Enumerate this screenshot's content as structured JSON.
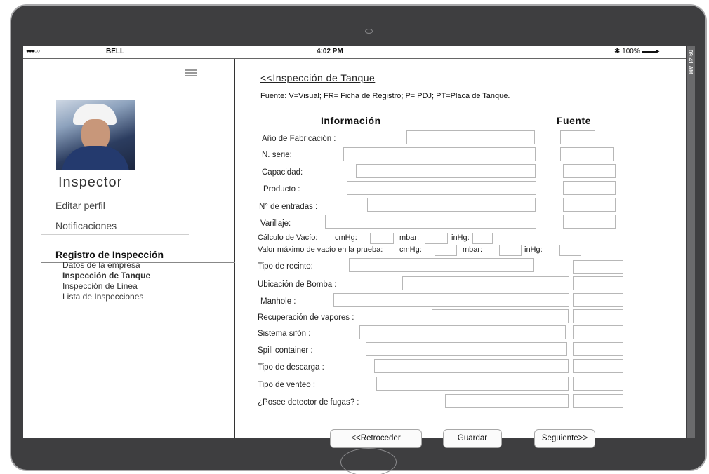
{
  "statusbar": {
    "carrier": "●●●○○",
    "network": "BELL",
    "time": "4:02 PM",
    "battery": "✱ 100% ▬▬▸"
  },
  "side_strip": "09:41 AM",
  "sidebar": {
    "name": "Inspector",
    "menu": [
      {
        "label": "Editar perfil"
      },
      {
        "label": "Notificaciones"
      }
    ],
    "group": {
      "label": "Registro de Inspección",
      "items": [
        {
          "label": "Datos de la empresa"
        },
        {
          "label": "Inspección de Tanque"
        },
        {
          "label": "Inspección de Linea"
        },
        {
          "label": "Lista de Inspecciones"
        }
      ]
    }
  },
  "main": {
    "back": "<<Inspección de Tanque",
    "legend": "Fuente: V=Visual; FR= Ficha de Registro; P= PDJ; PT=Placa de Tanque.",
    "col_info": "Información",
    "col_fuente": "Fuente",
    "fields": [
      {
        "label": "Año de Fabricación  :",
        "value": "",
        "fuente": ""
      },
      {
        "label": "N. serie:",
        "value": "",
        "fuente": ""
      },
      {
        "label": "Capacidad:",
        "value": "",
        "fuente": ""
      },
      {
        "label": "Producto :",
        "value": "",
        "fuente": ""
      },
      {
        "label": "N° de entradas  :",
        "value": "",
        "fuente": ""
      },
      {
        "label": "Varillaje:",
        "value": "",
        "fuente": ""
      }
    ],
    "vacio": {
      "calc_label": "Cálculo de Vacío:",
      "max_label": "Valor máximo de vacío en la prueba:",
      "units": [
        "cmHg:",
        "mbar:",
        "inHg:"
      ]
    },
    "fields2": [
      {
        "label": "Tipo de recinto:",
        "value": "",
        "fuente": ""
      },
      {
        "label": "Ubicación de Bomba   :",
        "value": "",
        "fuente": ""
      },
      {
        "label": "Manhole :",
        "value": "",
        "fuente": ""
      },
      {
        "label": "Recuperación de vapores   :",
        "value": "",
        "fuente": ""
      },
      {
        "label": "Sistema sifón  :",
        "value": "",
        "fuente": ""
      },
      {
        "label": "Spill container  :",
        "value": "",
        "fuente": ""
      },
      {
        "label": "Tipo de descarga :",
        "value": "",
        "fuente": ""
      },
      {
        "label": "Tipo de venteo  :",
        "value": "",
        "fuente": ""
      },
      {
        "label": "¿Posee detector de fugas?   :",
        "value": "",
        "fuente": ""
      }
    ]
  },
  "buttons": {
    "back": "<<Retroceder",
    "save": "Guardar",
    "next": "Seguiente>>"
  }
}
